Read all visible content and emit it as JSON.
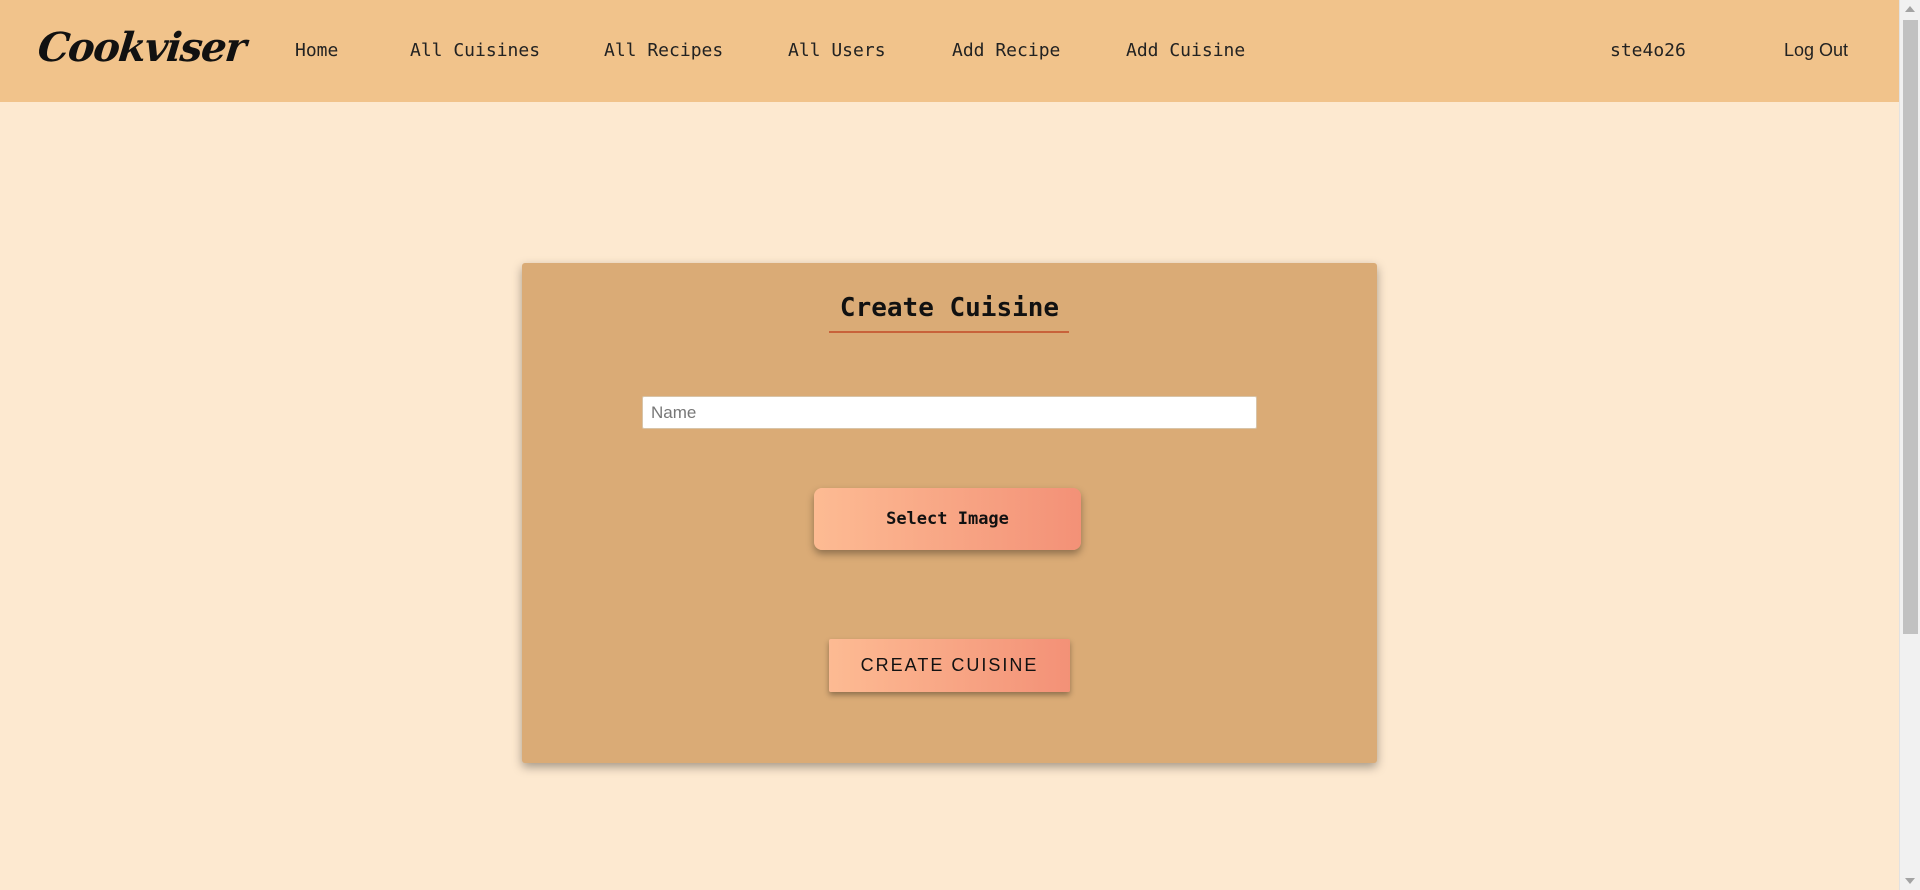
{
  "header": {
    "brand": "Cookviser",
    "nav": {
      "home": "Home",
      "all_cuisines": "All Cuisines",
      "all_recipes": "All Recipes",
      "all_users": "All Users",
      "add_recipe": "Add Recipe",
      "add_cuisine": "Add Cuisine"
    },
    "username": "ste4o26",
    "logout": "Log Out"
  },
  "form": {
    "title": "Create Cuisine",
    "name_value": "",
    "name_placeholder": "Name",
    "select_image_label": "Select Image",
    "submit_label": "CREATE CUISINE"
  },
  "colors": {
    "header_bg": "#f1c38b",
    "page_bg": "#fde9d0",
    "card_bg": "#daab76",
    "accent": "#c8623a",
    "button_gradient_start": "#fdbb93",
    "button_gradient_end": "#f39177"
  }
}
